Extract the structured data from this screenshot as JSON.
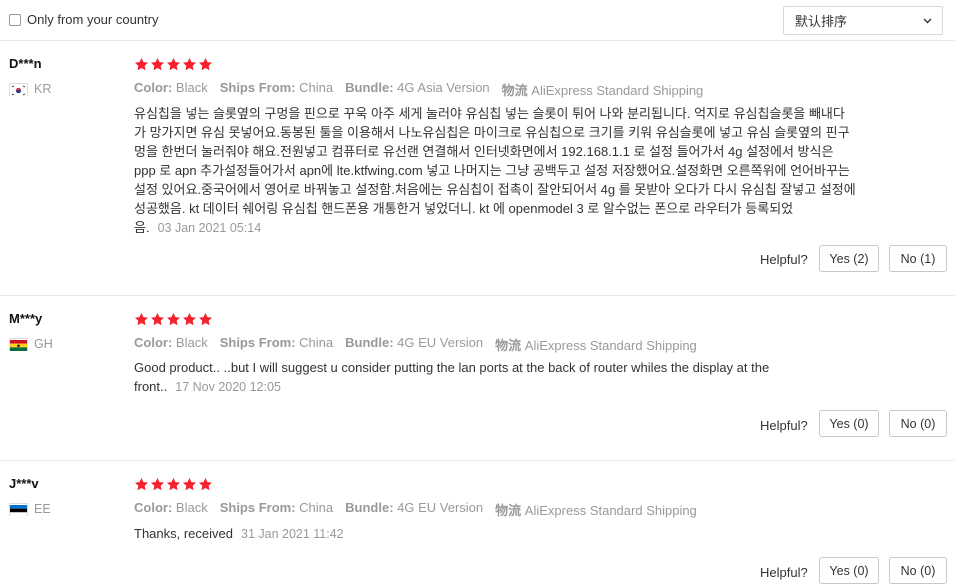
{
  "filter": {
    "only_country_label": "Only from your country",
    "checked": false
  },
  "sort": {
    "selected": "默认排序"
  },
  "helpful_label": "Helpful?",
  "reviews": [
    {
      "user": "D***n",
      "country": "KR",
      "rating": 5,
      "attrs": [
        {
          "key": "Color:",
          "value": "Black"
        },
        {
          "key": "Ships From:",
          "value": "China"
        },
        {
          "key": "Bundle:",
          "value": "4G Asia Version"
        },
        {
          "key": "物流",
          "value": "AliExpress Standard Shipping"
        }
      ],
      "text": "유심칩을 넣는 슬롯옆의 구멍을 핀으로 꾸욱 아주 세게 눌러야 유심칩 넣는 슬롯이 튀어 나와 분리됩니다. 억지로 유심칩슬롯을 빼내다가 망가지면 유심 못넣어요.동봉된 툴을 이용해서 나노유심칩은 마이크로 유심칩으로 크기를 키워 유심슬롯에 넣고 유심 슬롯옆의 핀구멍을 한번더 눌러줘야 해요.전원넣고 컴퓨터로 유선랜 연결해서 인터넷화면에서 192.168.1.1 로 설정 들어가서 4g 설정에서 방식은 ppp 로 apn 추가설정들어가서 apn에 lte.ktfwing.com 넣고 나머지는 그냥 공백두고 설정 저장했어요.설정화면 오른쪽위에 언어바꾸는 설정 있어요.중국어에서 영어로 바꿔놓고 설정함.처음에는 유심칩이 접촉이 잘안되어서 4g 를 못받아 오다가 다시 유심칩 잘넣고 설정에 성공했음. kt 데이터 쉐어링 유심칩 핸드폰용 개통한거 넣었더니. kt 에 openmodel 3 로 알수없는 폰으로 라우터가 등록되었음.",
      "date": "03 Jan 2021 05:14",
      "yes": "Yes (2)",
      "no": "No (1)"
    },
    {
      "user": "M***y",
      "country": "GH",
      "rating": 5,
      "attrs": [
        {
          "key": "Color:",
          "value": "Black"
        },
        {
          "key": "Ships From:",
          "value": "China"
        },
        {
          "key": "Bundle:",
          "value": "4G EU Version"
        },
        {
          "key": "物流",
          "value": "AliExpress Standard Shipping"
        }
      ],
      "text": "Good product.. ..but I will suggest u consider putting the lan ports at the back of router whiles the display at the front..",
      "date": "17 Nov 2020 12:05",
      "yes": "Yes (0)",
      "no": "No (0)"
    },
    {
      "user": "J***v",
      "country": "EE",
      "rating": 5,
      "attrs": [
        {
          "key": "Color:",
          "value": "Black"
        },
        {
          "key": "Ships From:",
          "value": "China"
        },
        {
          "key": "Bundle:",
          "value": "4G EU Version"
        },
        {
          "key": "物流",
          "value": "AliExpress Standard Shipping"
        }
      ],
      "text": "Thanks, received",
      "date": "31 Jan 2021 11:42",
      "yes": "Yes (0)",
      "no": "No (0)"
    }
  ],
  "colors": {
    "star": "#f5222d",
    "muted": "#999999",
    "border": "#e8e8e8"
  }
}
